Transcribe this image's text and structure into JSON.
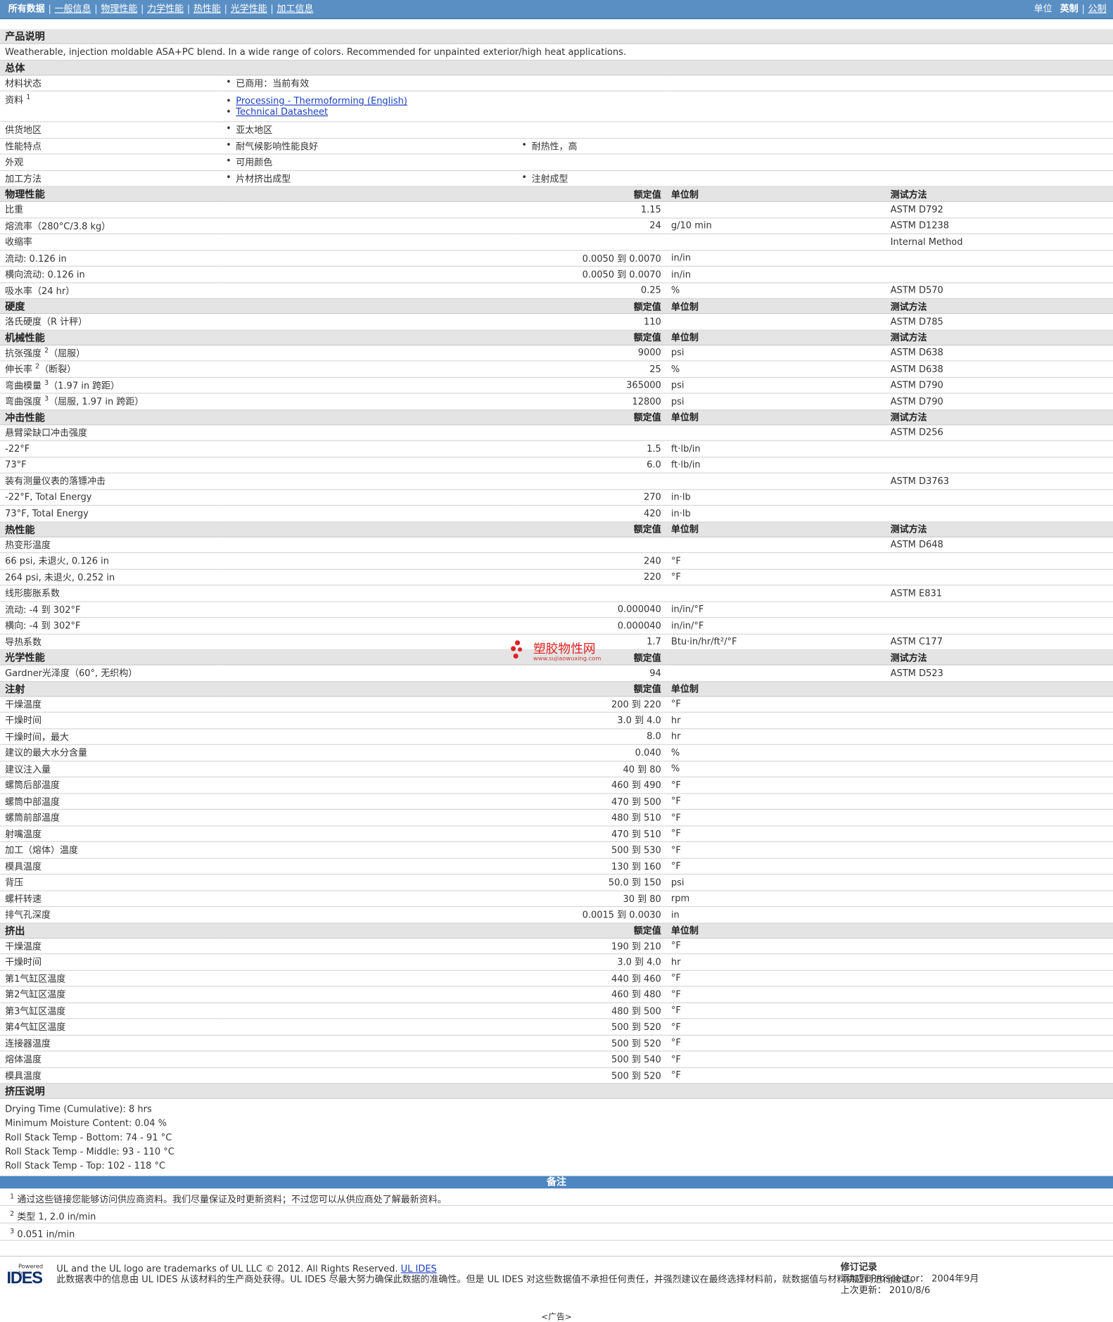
{
  "topbar": {
    "all_data": "所有数据",
    "tabs": [
      "一般信息",
      "物理性能",
      "力学性能",
      "热性能",
      "光学性能",
      "加工信息"
    ],
    "units_label": "单位",
    "unit_en": "英制",
    "unit_metric": "公制"
  },
  "product": {
    "heading": "产品说明",
    "description": "Weatherable, injection moldable ASA+PC blend. In a wide range of colors. Recommended for unpainted exterior/high heat applications."
  },
  "general": {
    "heading": "总体",
    "material_status_label": "材料状态",
    "material_status": "已商用：当前有效",
    "docs_label": "资料",
    "docs_sup": "1",
    "doc1": "Processing - Thermoforming (English)",
    "doc2": "Technical Datasheet",
    "region_label": "供货地区",
    "region": "亚太地区",
    "features_label": "性能特点",
    "feature1": "耐气候影响性能良好",
    "feature2": "耐热性，高",
    "appearance_label": "外观",
    "appearance": "可用颜色",
    "processing_label": "加工方法",
    "processing1": "片材挤出成型",
    "processing2": "注射成型"
  },
  "headers": {
    "nominal": "额定值",
    "unit": "单位制",
    "test": "测试方法"
  },
  "physical": {
    "heading": "物理性能",
    "rows": [
      {
        "label": "比重",
        "value": "1.15",
        "unit": "",
        "test": "ASTM D792",
        "indent": false
      },
      {
        "label": "熔流率（280°C/3.8 kg）",
        "value": "24",
        "unit": "g/10 min",
        "test": "ASTM D1238",
        "indent": false
      },
      {
        "label": "收缩率",
        "value": "",
        "unit": "",
        "test": "Internal Method",
        "indent": false
      },
      {
        "label": "流动: 0.126 in",
        "value": "0.0050 到  0.0070",
        "unit": "in/in",
        "test": "",
        "indent": true
      },
      {
        "label": "横向流动: 0.126 in",
        "value": "0.0050 到  0.0070",
        "unit": "in/in",
        "test": "",
        "indent": true
      },
      {
        "label": "吸水率（24 hr）",
        "value": "0.25",
        "unit": "%",
        "test": "ASTM D570",
        "indent": false
      }
    ]
  },
  "hardness": {
    "heading": "硬度",
    "rows": [
      {
        "label": "洛氏硬度（R 计秤）",
        "value": "110",
        "unit": "",
        "test": "ASTM D785",
        "indent": false
      }
    ]
  },
  "mechanical": {
    "heading": "机械性能",
    "rows": [
      {
        "label": "抗张强度",
        "sup": "2",
        "suffix": "（屈服）",
        "value": "9000",
        "unit": "psi",
        "test": "ASTM D638",
        "indent": false
      },
      {
        "label": "伸长率",
        "sup": "2",
        "suffix": "（断裂）",
        "value": "25",
        "unit": "%",
        "test": "ASTM D638",
        "indent": false
      },
      {
        "label": "弯曲模量",
        "sup": "3",
        "suffix": "（1.97 in 跨距）",
        "value": "365000",
        "unit": "psi",
        "test": "ASTM D790",
        "indent": false
      },
      {
        "label": "弯曲强度",
        "sup": "3",
        "suffix": "（屈服, 1.97 in 跨距）",
        "value": "12800",
        "unit": "psi",
        "test": "ASTM D790",
        "indent": false
      }
    ]
  },
  "impact": {
    "heading": "冲击性能",
    "rows": [
      {
        "label": "悬臂梁缺口冲击强度",
        "value": "",
        "unit": "",
        "test": "ASTM D256",
        "indent": false
      },
      {
        "label": "-22°F",
        "value": "1.5",
        "unit": "ft·lb/in",
        "test": "",
        "indent": true
      },
      {
        "label": "73°F",
        "value": "6.0",
        "unit": "ft·lb/in",
        "test": "",
        "indent": true
      },
      {
        "label": "装有测量仪表的落镖冲击",
        "value": "",
        "unit": "",
        "test": "ASTM D3763",
        "indent": false
      },
      {
        "label": "-22°F, Total Energy",
        "value": "270",
        "unit": "in·lb",
        "test": "",
        "indent": true
      },
      {
        "label": "73°F, Total Energy",
        "value": "420",
        "unit": "in·lb",
        "test": "",
        "indent": true
      }
    ]
  },
  "thermal": {
    "heading": "热性能",
    "rows": [
      {
        "label": "热变形温度",
        "value": "",
        "unit": "",
        "test": "ASTM D648",
        "indent": false
      },
      {
        "label": "66 psi, 未退火, 0.126 in",
        "value": "240",
        "unit": "°F",
        "test": "",
        "indent": true
      },
      {
        "label": "264 psi, 未退火, 0.252 in",
        "value": "220",
        "unit": "°F",
        "test": "",
        "indent": true
      },
      {
        "label": "线形膨胀系数",
        "value": "",
        "unit": "",
        "test": "ASTM E831",
        "indent": false
      },
      {
        "label": "流动: -4 到  302°F",
        "value": "0.000040",
        "unit": "in/in/°F",
        "test": "",
        "indent": true
      },
      {
        "label": "横向: -4 到  302°F",
        "value": "0.000040",
        "unit": "in/in/°F",
        "test": "",
        "indent": true
      },
      {
        "label": "导热系数",
        "value": "1.7",
        "unit": "Btu·in/hr/ft²/°F",
        "test": "ASTM C177",
        "indent": false
      }
    ]
  },
  "optical": {
    "heading": "光学性能",
    "rows": [
      {
        "label": "Gardner光泽度（60°, 无织构）",
        "value": "94",
        "unit": "",
        "test": "ASTM D523",
        "indent": false
      }
    ]
  },
  "injection": {
    "heading": "注射",
    "rows": [
      {
        "label": "干燥温度",
        "value": "200 到  220",
        "unit": "°F"
      },
      {
        "label": "干燥时间",
        "value": "3.0 到  4.0",
        "unit": "hr"
      },
      {
        "label": "干燥时间，最大",
        "value": "8.0",
        "unit": "hr"
      },
      {
        "label": "建议的最大水分含量",
        "value": "0.040",
        "unit": "%"
      },
      {
        "label": "建议注入量",
        "value": "40 到  80",
        "unit": "%"
      },
      {
        "label": "螺筒后部温度",
        "value": "460 到  490",
        "unit": "°F"
      },
      {
        "label": "螺筒中部温度",
        "value": "470 到  500",
        "unit": "°F"
      },
      {
        "label": "螺筒前部温度",
        "value": "480 到  510",
        "unit": "°F"
      },
      {
        "label": "射嘴温度",
        "value": "470 到  510",
        "unit": "°F"
      },
      {
        "label": "加工（熔体）温度",
        "value": "500 到  530",
        "unit": "°F"
      },
      {
        "label": "模具温度",
        "value": "130 到  160",
        "unit": "°F"
      },
      {
        "label": "背压",
        "value": "50.0 到  150",
        "unit": "psi"
      },
      {
        "label": "螺杆转速",
        "value": "30 到  80",
        "unit": "rpm"
      },
      {
        "label": "排气孔深度",
        "value": "0.0015 到  0.0030",
        "unit": "in"
      }
    ]
  },
  "extrusion": {
    "heading": "挤出",
    "rows": [
      {
        "label": "干燥温度",
        "value": "190 到  210",
        "unit": "°F"
      },
      {
        "label": "干燥时间",
        "value": "3.0 到  4.0",
        "unit": "hr"
      },
      {
        "label": "第1气缸区温度",
        "value": "440 到  460",
        "unit": "°F"
      },
      {
        "label": "第2气缸区温度",
        "value": "460 到  480",
        "unit": "°F"
      },
      {
        "label": "第3气缸区温度",
        "value": "480 到  500",
        "unit": "°F"
      },
      {
        "label": "第4气缸区温度",
        "value": "500 到  520",
        "unit": "°F"
      },
      {
        "label": "连接器温度",
        "value": "500 到  520",
        "unit": "°F"
      },
      {
        "label": "熔体温度",
        "value": "500 到  540",
        "unit": "°F"
      },
      {
        "label": "模具温度",
        "value": "500 到  520",
        "unit": "°F"
      }
    ]
  },
  "extrusion_notes": {
    "heading": "挤压说明",
    "lines": [
      "Drying Time (Cumulative): 8 hrs",
      "Minimum Moisture Content: 0.04 %",
      "Roll Stack Temp - Bottom: 74 - 91 °C",
      "Roll Stack Temp - Middle: 93 - 110 °C",
      "Roll Stack Temp - Top: 102 - 118 °C"
    ]
  },
  "notes": {
    "heading": "备注",
    "items": [
      {
        "num": "1",
        "text": "通过这些链接您能够访问供应商资料。我们尽量保证及时更新资料；不过您可以从供应商处了解最新资料。"
      },
      {
        "num": "2",
        "text": "类型  1, 2.0 in/min"
      },
      {
        "num": "3",
        "text": "0.051 in/min"
      }
    ]
  },
  "footer": {
    "powered_by": "Powered by",
    "logo_text": "IDES",
    "trademark": "UL and the UL logo are trademarks of UL LLC © 2012. All Rights Reserved.",
    "trademark_link": "UL IDES",
    "disclaimer": "此数据表中的信息由  UL IDES 从该材料的生产商处获得。UL IDES 尽最大努力确保此数据的准确性。但是  UL IDES 对这些数据值不承担任何责任，并强烈建议在最终选择材料前，就数据值与材料供应商进行验证。",
    "revision_heading": "修订记录",
    "added_label": "添加到  Prospector：",
    "added_value": "2004年9月",
    "updated_label": "上次更新：",
    "updated_value": "2010/8/6",
    "ad": "<广告>"
  },
  "watermark": {
    "text": "塑胶物性网",
    "url": "www.sujiaowuxing.com"
  }
}
